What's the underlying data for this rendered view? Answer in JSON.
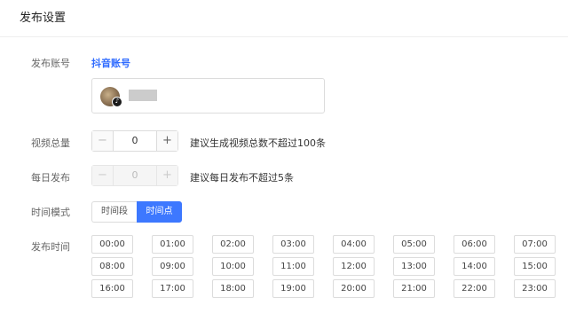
{
  "header": {
    "title": "发布设置"
  },
  "account": {
    "label": "发布账号",
    "link_text": "抖音账号",
    "avatar_icon": "user-avatar",
    "platform_icon": "tiktok-icon",
    "platform_glyph": "♪"
  },
  "video_total": {
    "label": "视频总量",
    "minus": "−",
    "value": "0",
    "plus": "+",
    "hint": "建议生成视频总数不超过100条"
  },
  "daily_publish": {
    "label": "每日发布",
    "minus": "−",
    "value": "0",
    "plus": "+",
    "hint": "建议每日发布不超过5条"
  },
  "time_mode": {
    "label": "时间模式",
    "options": [
      "时间段",
      "时间点"
    ],
    "selected": "时间点"
  },
  "publish_time": {
    "label": "发布时间",
    "slots": [
      "00:00",
      "01:00",
      "02:00",
      "03:00",
      "04:00",
      "05:00",
      "06:00",
      "07:00",
      "08:00",
      "09:00",
      "10:00",
      "11:00",
      "12:00",
      "13:00",
      "14:00",
      "15:00",
      "16:00",
      "17:00",
      "18:00",
      "19:00",
      "20:00",
      "21:00",
      "22:00",
      "23:00"
    ]
  },
  "colors": {
    "accent": "#3d78ff",
    "link": "#2f6bff",
    "border": "#dcdcdc"
  }
}
